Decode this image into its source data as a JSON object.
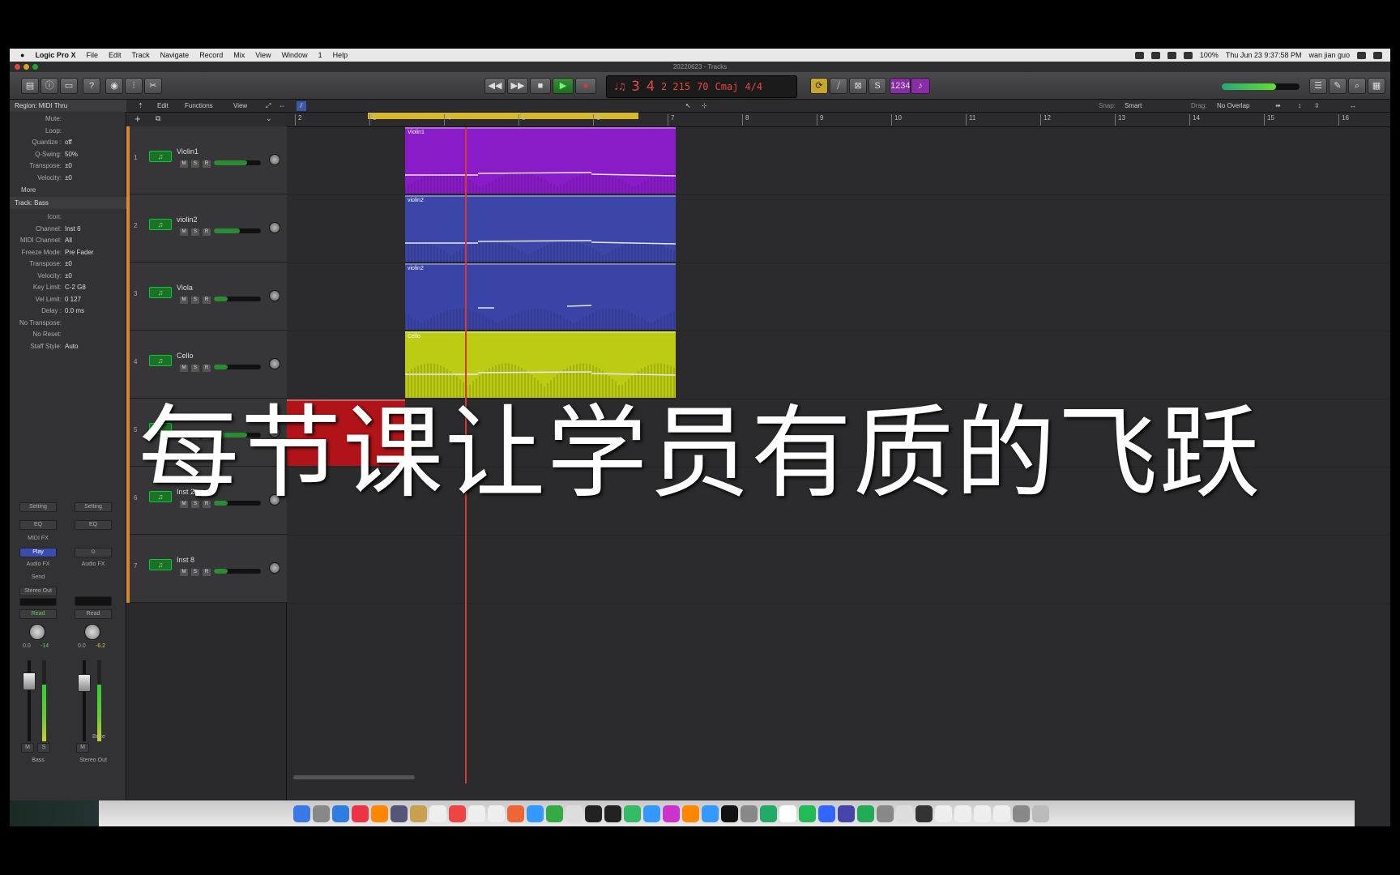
{
  "menubar": {
    "app": "Logic Pro X",
    "items": [
      "File",
      "Edit",
      "Track",
      "Navigate",
      "Record",
      "Mix",
      "View",
      "Window",
      "1",
      "Help"
    ],
    "battery": "100%",
    "datetime": "Thu Jun 23  9:37:58 PM",
    "user": "wan jian guo"
  },
  "window": {
    "title": "20220623 - Tracks"
  },
  "lcd": {
    "bar": "3",
    "beat": "4",
    "div_tick": "2  215",
    "tempo": "70",
    "key": "Cmaj",
    "signature": "4/4"
  },
  "inspector": {
    "region_header": "Region: MIDI Thru",
    "region_rows": [
      {
        "k": "Mute:",
        "v": ""
      },
      {
        "k": "Loop:",
        "v": ""
      },
      {
        "k": "Quantize :",
        "v": "off"
      },
      {
        "k": "Q-Swing:",
        "v": "50%"
      },
      {
        "k": "Transpose:",
        "v": "±0"
      },
      {
        "k": "Velocity:",
        "v": "±0"
      }
    ],
    "more": "More",
    "track_header": "Track: Bass",
    "track_rows": [
      {
        "k": "Icon:",
        "v": ""
      },
      {
        "k": "Channel:",
        "v": "Inst 6"
      },
      {
        "k": "MIDI Channel:",
        "v": "All"
      },
      {
        "k": "Freeze Mode:",
        "v": "Pre Fader"
      },
      {
        "k": "Transpose:",
        "v": "±0"
      },
      {
        "k": "Velocity:",
        "v": "±0"
      },
      {
        "k": "Key Limit:",
        "v": "C-2    G8"
      },
      {
        "k": "Vel Limit:",
        "v": "0    127"
      },
      {
        "k": "Delay :",
        "v": "0.0 ms"
      },
      {
        "k": "No Transpose:",
        "v": ""
      },
      {
        "k": "No Reset:",
        "v": ""
      },
      {
        "k": "Staff Style:",
        "v": "Auto"
      }
    ],
    "strip_left": {
      "setting": "Setting",
      "eq": "EQ",
      "midi_fx": "MIDI FX",
      "plugin": "Play",
      "audio_fx": "Audio FX",
      "send": "Send",
      "output": "Stereo Out",
      "mode": "Read",
      "val1": "0.0",
      "val2": "-14",
      "m": "M",
      "s": "S",
      "name": "Bass"
    },
    "strip_right": {
      "setting": "Setting",
      "eq": "EQ",
      "audio_fx": "Audio FX",
      "mode": "Read",
      "val1": "0.0",
      "val2": "-6.2",
      "bnce": "Bnce",
      "m": "M",
      "name": "Stereo Out"
    }
  },
  "tracks_toolbar": {
    "edit": "Edit",
    "functions": "Functions",
    "view": "View",
    "snap_label": "Snap:",
    "snap": "Smart",
    "drag_label": "Drag:",
    "drag": "No Overlap"
  },
  "ruler": [
    "2",
    "3",
    "4",
    "5",
    "6",
    "7",
    "8",
    "9",
    "10",
    "11",
    "12",
    "13",
    "14",
    "15",
    "16"
  ],
  "tracks": [
    {
      "num": "1",
      "name": "Violin1",
      "region": "Violin1",
      "color": "#8a1bc8",
      "vol": 0.7
    },
    {
      "num": "2",
      "name": "violin2",
      "region": "violin2",
      "color": "#3b46a8",
      "vol": 0.55
    },
    {
      "num": "3",
      "name": "Viola",
      "region": "violin2",
      "color": "#3a44a6",
      "vol": 0.3
    },
    {
      "num": "4",
      "name": "Cello",
      "region": "Cello",
      "color": "#bccc12",
      "vol": 0.3
    },
    {
      "num": "5",
      "name": "",
      "region": "",
      "color": "#b01418",
      "vol": 0.7
    },
    {
      "num": "6",
      "name": "Inst 2",
      "region": "",
      "color": "",
      "vol": 0.3
    },
    {
      "num": "7",
      "name": "Inst 8",
      "region": "",
      "color": "",
      "vol": 0.3
    }
  ],
  "overlay_text": "每节课让学员有质的飞跃",
  "msr": [
    "M",
    "S",
    "R"
  ]
}
